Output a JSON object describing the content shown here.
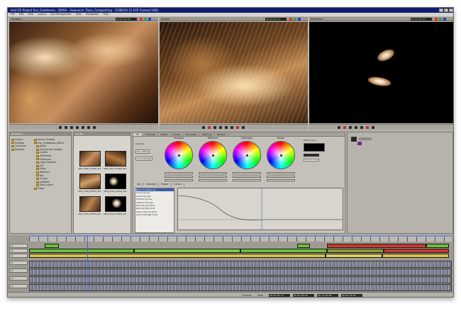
{
  "window": {
    "title": "Avid DS Project Sun_Goddesses - DMGA - Sequence: Daze_Compositing - [1080/24 23.976 Frames] (HD)"
  },
  "menu": [
    "File",
    "Edit",
    "View",
    "Layout",
    "Clip Management",
    "Tools",
    "Navigation",
    "Help"
  ],
  "monitors": [
    {
      "label": "Playback",
      "timecode": "00:00:00:00"
    },
    {
      "label": "Current",
      "timecode": "00:05:09:14"
    },
    {
      "label": "Reference",
      "timecode": "00:00:00:00"
    }
  ],
  "explorer": {
    "header": "Workspace",
    "left_items": [
      "Project",
      "Desktop",
      "Computer",
      "Network"
    ],
    "tree": [
      "Factory Presets",
      "Dan_Goddesses_DMGA",
      "Audio",
      "Comparison Images",
      "Credits",
      "DSPresets",
      "FinalLayer",
      "Logo_Graphics",
      "LUT",
      "Music",
      "Referenz",
      "Rez",
      "Scripts",
      "Subtitles",
      "Shot_Layers",
      "Video"
    ]
  },
  "bin": {
    "header": "Clip Bin",
    "thumbs": [
      "A003_C002_0729VE_001",
      "A004_C001_0729VE_001",
      "A003_C019_07250V_001",
      "A003_C019_07250V_002",
      "A003_C021_0729TT_001",
      "A003_C022_07250S_001"
    ]
  },
  "color": {
    "tabs": [
      "HSL",
      "Channels",
      "Levels",
      "Curves",
      "Secondary",
      "Matchup",
      "Options"
    ],
    "wheels": [
      "Shadows",
      "Midtones",
      "Highlights",
      "Master"
    ],
    "match_label": "Match Color",
    "buttons": [
      "Controls",
      "Hue Offset",
      "Luma Ranges"
    ],
    "curve_tabs": [
      "Sat",
      "Channels",
      "Viewer",
      "Curves"
    ],
    "parameters": [
      "Color Correction (1)",
      "Luma clip low",
      "Luma clip high",
      "Chroma clip low",
      "Chroma clip high",
      "Red Clip Low Limit",
      "Red Clip High Limit",
      "Green Clip Low Limit",
      "Green Clip High Limit"
    ]
  },
  "timeline": {
    "tracks": [
      "V3",
      "V2",
      "V1",
      "A1",
      "A2",
      "A3",
      "A4"
    ]
  },
  "status": {
    "timeline_label": "Timeline",
    "snap": "Snap",
    "timecodes": [
      "00:05:09:14",
      "00:00:00:00",
      "00:10:00:00",
      "00:00:00:00"
    ]
  },
  "colors": {
    "clip_green": "#6bbf3a",
    "clip_yellow": "#d8c24a",
    "clip_red": "#c9382e",
    "clip_olive": "#8f9a35",
    "playhead": "#3d63d9"
  }
}
